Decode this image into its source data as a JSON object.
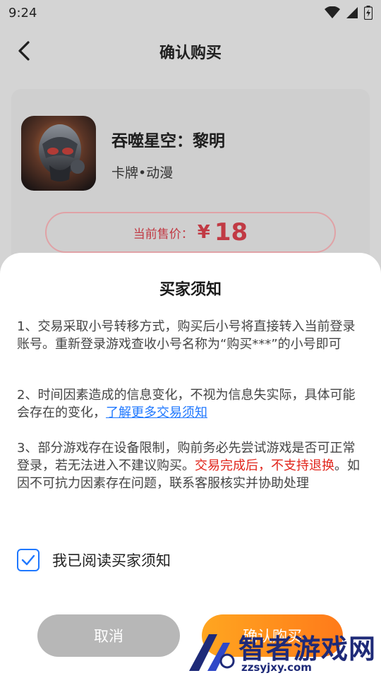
{
  "status_bar": {
    "time": "9:24",
    "icons": [
      "wifi-icon",
      "signal-icon",
      "battery-icon"
    ]
  },
  "header": {
    "back_icon": "chevron-left-icon",
    "title": "确认购买"
  },
  "product": {
    "name": "吞噬星空：黎明",
    "tags": "卡牌•动漫",
    "price_label": "当前售价：",
    "price_symbol": "¥",
    "price_value": "18"
  },
  "sheet": {
    "title": "买家须知",
    "notice_1": "1、交易采取小号转移方式，购买后小号将直接转入当前登录账号。重新登录游戏查收小号名称为“购买***”的小号即可",
    "notice_2_text": "2、时间因素造成的信息变化，不视为信息失实际，具体可能会存在的变化，",
    "notice_2_link": "了解更多交易须知",
    "notice_3_a": "3、部分游戏存在设备限制，购前务必先尝试游戏是否可正常登录，若无法进入不建议购买。",
    "notice_3_warn": "交易完成后，不支持退换",
    "notice_3_b": "。如因不可抗力因素存在问题，联系客服核实并协助处理",
    "agree_label": "我已阅读买家须知",
    "agree_checked": true,
    "cancel_label": "取消",
    "confirm_label": "确认购买"
  },
  "watermark": {
    "title": "智者游戏网",
    "url": "zzsyjxy.com"
  },
  "colors": {
    "accent_blue": "#1f78ff",
    "price_red": "#c13a44",
    "warn_red": "#e1251b",
    "confirm_orange": "#ff8a1a",
    "cancel_gray": "#b7b7b7"
  }
}
